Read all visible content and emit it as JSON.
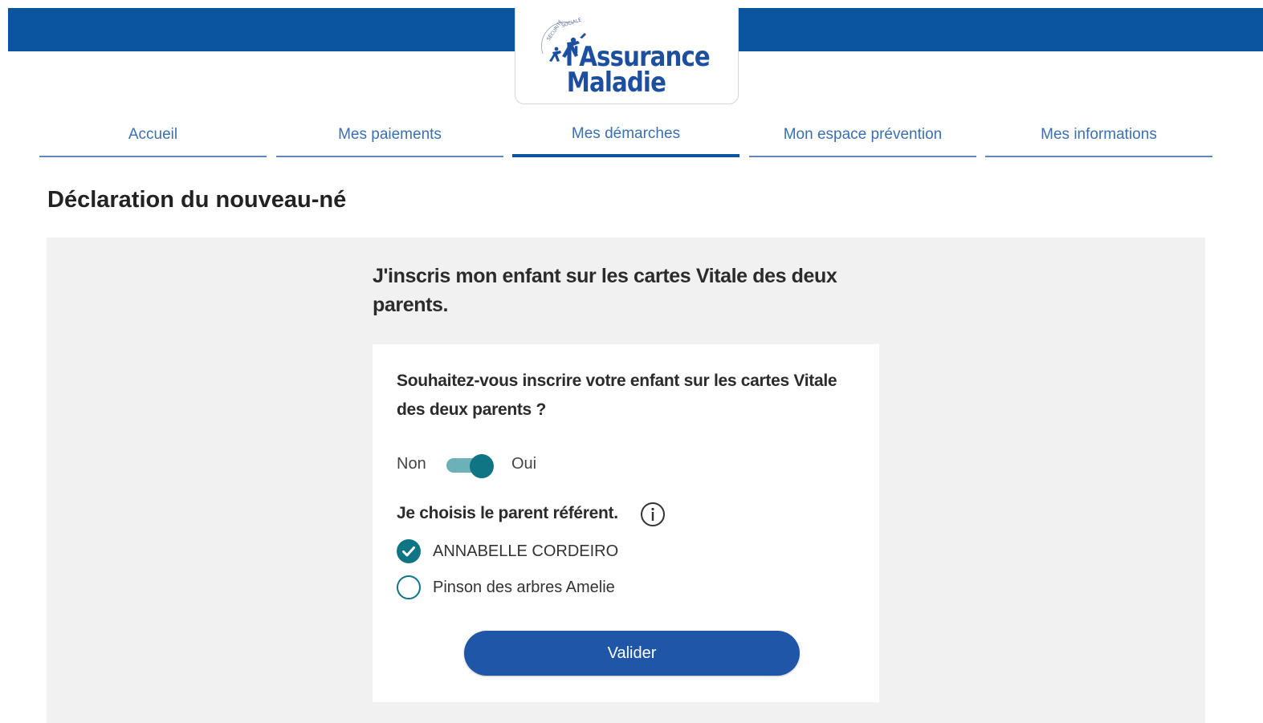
{
  "header": {
    "logo": {
      "seal_text": "SÉCURITÉ SOCIALE",
      "line1": "l'Assurance",
      "line2": "Maladie"
    },
    "brand_color": "#0a54a0"
  },
  "nav": {
    "tabs": [
      {
        "label": "Accueil",
        "active": false
      },
      {
        "label": "Mes paiements",
        "active": false
      },
      {
        "label": "Mes démarches",
        "active": true
      },
      {
        "label": "Mon espace prévention",
        "active": false
      },
      {
        "label": "Mes informations",
        "active": false
      }
    ]
  },
  "page": {
    "title": "Déclaration du nouveau-né"
  },
  "form": {
    "heading": "J'inscris mon enfant sur les cartes Vitale des deux parents.",
    "question": "Souhaitez-vous inscrire votre enfant sur les cartes Vitale des deux parents ?",
    "toggle": {
      "off_label": "Non",
      "on_label": "Oui",
      "value": "Oui"
    },
    "referent_label": "Je choisis le parent référent.",
    "parents": [
      {
        "name": "ANNABELLE CORDEIRO",
        "selected": true
      },
      {
        "name": "Pinson des arbres Amelie",
        "selected": false
      }
    ],
    "submit_label": "Valider",
    "accent_color": "#0f7585"
  }
}
